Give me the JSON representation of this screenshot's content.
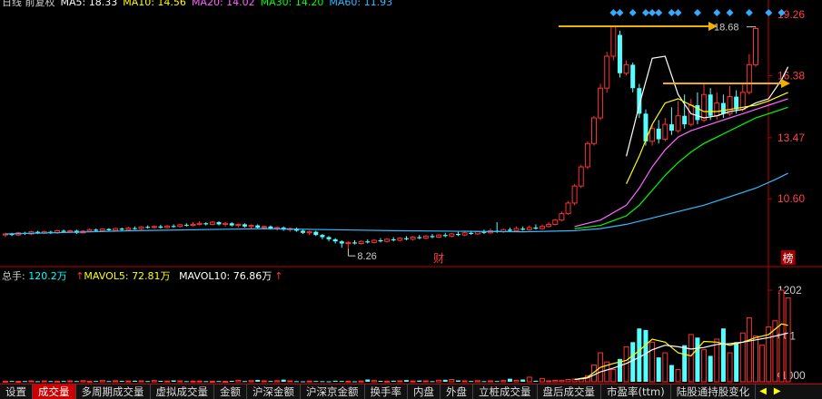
{
  "top_legend": {
    "items": [
      {
        "label": "日线 前复权",
        "color": "#cccccc"
      },
      {
        "label": "MA5: 18.33",
        "color": "#ffffff"
      },
      {
        "label": "MA10: 14.56",
        "color": "#ffff00"
      },
      {
        "label": "MA20: 14.02",
        "color": "#ff66ff"
      },
      {
        "label": "MA30: 14.20",
        "color": "#00ff00"
      },
      {
        "label": "MA60: 11.93",
        "color": "#33bbff"
      }
    ]
  },
  "volume_legend": {
    "total_label": "总手: ",
    "total_value": "120.2万",
    "mavol5_label": "MAVOL5: ",
    "mavol5_value": "72.81万",
    "mavol10_label": "MAVOL10: ",
    "mavol10_value": "76.86万"
  },
  "tabs": [
    "设置",
    "成交量",
    "多周期成交量",
    "虚拟成交量",
    "金额",
    "沪深金额",
    "沪深京金额",
    "换手率",
    "内盘",
    "外盘",
    "立桩成交量",
    "盘后成交量",
    "市盈率(ttm)",
    "陆股通持股变化"
  ],
  "active_tab": "成交量",
  "tab_arrows": [
    "◀",
    "▶"
  ],
  "colors": {
    "up": "#ff3232",
    "down": "#54ffff",
    "axis": "#c00000",
    "price_label": "#ff4040",
    "annotation_arrow": "#f0b000",
    "diamond": "#33aaff"
  },
  "chart_data": [
    {
      "type": "candlestick",
      "ylim": [
        7.5,
        19.6
      ],
      "yticks": [
        "19.26",
        "16.38",
        "13.47",
        "10.60"
      ],
      "annotations": {
        "high": "18.68",
        "low": "8.26",
        "markers": [
          "财",
          "榜"
        ]
      },
      "series": [
        {
          "name": "MA5",
          "color": "#ffffff"
        },
        {
          "name": "MA10",
          "color": "#ffff00"
        },
        {
          "name": "MA20",
          "color": "#ff66ff"
        },
        {
          "name": "MA30",
          "color": "#00ff00"
        },
        {
          "name": "MA60",
          "color": "#33bbff"
        }
      ],
      "candles": [
        [
          8.9,
          8.95,
          8.8,
          9.0
        ],
        [
          8.95,
          8.9,
          8.85,
          9.0
        ],
        [
          8.9,
          9.0,
          8.85,
          9.05
        ],
        [
          9.0,
          8.95,
          8.9,
          9.05
        ],
        [
          8.95,
          9.05,
          8.9,
          9.1
        ],
        [
          9.05,
          8.98,
          8.95,
          9.1
        ],
        [
          8.98,
          9.05,
          8.95,
          9.1
        ],
        [
          9.05,
          9.0,
          8.95,
          9.1
        ],
        [
          9.0,
          9.1,
          8.95,
          9.15
        ],
        [
          9.1,
          9.05,
          9.0,
          9.15
        ],
        [
          9.05,
          9.1,
          9.0,
          9.15
        ],
        [
          9.1,
          9.0,
          8.95,
          9.15
        ],
        [
          9.0,
          9.08,
          8.98,
          9.12
        ],
        [
          9.08,
          9.15,
          9.05,
          9.2
        ],
        [
          9.15,
          9.1,
          9.05,
          9.2
        ],
        [
          9.1,
          9.18,
          9.05,
          9.22
        ],
        [
          9.18,
          9.12,
          9.1,
          9.22
        ],
        [
          9.12,
          9.2,
          9.1,
          9.25
        ],
        [
          9.2,
          9.15,
          9.1,
          9.25
        ],
        [
          9.15,
          9.22,
          9.1,
          9.28
        ],
        [
          9.22,
          9.2,
          9.15,
          9.3
        ],
        [
          9.2,
          9.28,
          9.15,
          9.32
        ],
        [
          9.28,
          9.25,
          9.2,
          9.35
        ],
        [
          9.25,
          9.3,
          9.2,
          9.35
        ],
        [
          9.3,
          9.25,
          9.2,
          9.38
        ],
        [
          9.25,
          9.32,
          9.2,
          9.38
        ],
        [
          9.32,
          9.3,
          9.25,
          9.4
        ],
        [
          9.3,
          9.38,
          9.25,
          9.42
        ],
        [
          9.38,
          9.35,
          9.3,
          9.45
        ],
        [
          9.35,
          9.4,
          9.3,
          9.5
        ],
        [
          9.4,
          9.45,
          9.35,
          9.55
        ],
        [
          9.45,
          9.4,
          9.35,
          9.5
        ],
        [
          9.4,
          9.5,
          9.35,
          9.55
        ],
        [
          9.5,
          9.4,
          9.35,
          9.55
        ],
        [
          9.4,
          9.45,
          9.3,
          9.5
        ],
        [
          9.45,
          9.35,
          9.3,
          9.5
        ],
        [
          9.35,
          9.4,
          9.25,
          9.45
        ],
        [
          9.4,
          9.3,
          9.25,
          9.45
        ],
        [
          9.3,
          9.35,
          9.2,
          9.4
        ],
        [
          9.35,
          9.25,
          9.2,
          9.4
        ],
        [
          9.25,
          9.3,
          9.15,
          9.35
        ],
        [
          9.3,
          9.2,
          9.15,
          9.35
        ],
        [
          9.2,
          9.25,
          9.1,
          9.3
        ],
        [
          9.25,
          9.15,
          9.1,
          9.3
        ],
        [
          9.15,
          9.2,
          9.05,
          9.25
        ],
        [
          9.2,
          9.1,
          9.05,
          9.25
        ],
        [
          9.1,
          9.0,
          8.95,
          9.15
        ],
        [
          9.0,
          9.05,
          8.9,
          9.1
        ],
        [
          9.05,
          8.9,
          8.85,
          9.1
        ],
        [
          8.9,
          8.8,
          8.7,
          8.95
        ],
        [
          8.8,
          8.7,
          8.6,
          8.85
        ],
        [
          8.7,
          8.6,
          8.5,
          8.75
        ],
        [
          8.6,
          8.5,
          8.3,
          8.65
        ],
        [
          8.5,
          8.55,
          8.26,
          8.6
        ],
        [
          8.55,
          8.5,
          8.45,
          8.65
        ],
        [
          8.5,
          8.6,
          8.45,
          8.65
        ],
        [
          8.6,
          8.55,
          8.5,
          8.7
        ],
        [
          8.55,
          8.65,
          8.5,
          8.7
        ],
        [
          8.65,
          8.6,
          8.55,
          8.75
        ],
        [
          8.6,
          8.7,
          8.55,
          8.75
        ],
        [
          8.7,
          8.65,
          8.6,
          8.8
        ],
        [
          8.65,
          8.75,
          8.6,
          8.8
        ],
        [
          8.75,
          8.7,
          8.65,
          8.85
        ],
        [
          8.7,
          8.8,
          8.65,
          8.85
        ],
        [
          8.8,
          8.75,
          8.7,
          8.9
        ],
        [
          8.75,
          8.85,
          8.7,
          8.9
        ],
        [
          8.85,
          8.8,
          8.75,
          8.95
        ],
        [
          8.8,
          8.9,
          8.75,
          8.95
        ],
        [
          8.9,
          8.85,
          8.8,
          9.0
        ],
        [
          8.85,
          8.95,
          8.8,
          9.0
        ],
        [
          8.95,
          8.9,
          8.85,
          9.05
        ],
        [
          8.9,
          9.0,
          8.85,
          9.05
        ],
        [
          9.0,
          8.95,
          8.9,
          9.1
        ],
        [
          8.95,
          9.05,
          8.9,
          9.1
        ],
        [
          9.05,
          9.0,
          8.95,
          9.15
        ],
        [
          9.0,
          9.1,
          8.95,
          9.2
        ],
        [
          9.1,
          9.05,
          9.0,
          9.5
        ],
        [
          9.05,
          9.15,
          9.0,
          9.2
        ],
        [
          9.15,
          9.1,
          9.05,
          9.25
        ],
        [
          9.1,
          9.2,
          9.05,
          9.3
        ],
        [
          9.2,
          9.15,
          9.1,
          9.3
        ],
        [
          9.15,
          9.25,
          9.1,
          9.35
        ],
        [
          9.25,
          9.2,
          9.15,
          9.4
        ],
        [
          9.2,
          9.3,
          9.15,
          9.4
        ],
        [
          9.3,
          9.4,
          9.25,
          9.5
        ],
        [
          9.4,
          9.6,
          9.35,
          9.65
        ],
        [
          9.6,
          9.9,
          9.55,
          10.0
        ],
        [
          9.9,
          10.4,
          9.85,
          10.5
        ],
        [
          10.4,
          11.2,
          10.3,
          11.3
        ],
        [
          11.2,
          12.1,
          11.1,
          12.2
        ],
        [
          12.1,
          13.2,
          12.0,
          13.3
        ],
        [
          13.2,
          14.4,
          13.1,
          14.5
        ],
        [
          14.4,
          15.8,
          14.3,
          16.0
        ],
        [
          15.8,
          17.3,
          15.6,
          17.5
        ],
        [
          17.3,
          18.68,
          17.1,
          18.68
        ],
        [
          18.3,
          16.5,
          16.3,
          18.5
        ],
        [
          16.5,
          16.9,
          16.4,
          17.1
        ],
        [
          16.9,
          15.8,
          15.6,
          17.0
        ],
        [
          15.8,
          14.6,
          14.4,
          16.0
        ],
        [
          14.6,
          13.3,
          13.1,
          14.8
        ],
        [
          13.3,
          13.9,
          13.1,
          14.1
        ],
        [
          13.9,
          13.4,
          13.2,
          14.3
        ],
        [
          13.4,
          14.1,
          13.3,
          14.4
        ],
        [
          14.1,
          13.8,
          13.6,
          14.9
        ],
        [
          13.8,
          14.5,
          13.7,
          15.2
        ],
        [
          14.5,
          14.1,
          13.9,
          15.5
        ],
        [
          14.1,
          15.0,
          14.0,
          15.3
        ],
        [
          15.0,
          14.3,
          14.1,
          15.6
        ],
        [
          14.3,
          15.5,
          14.2,
          16.0
        ],
        [
          15.5,
          14.5,
          14.3,
          15.8
        ],
        [
          14.5,
          15.1,
          14.3,
          15.6
        ],
        [
          15.1,
          14.6,
          14.4,
          15.5
        ],
        [
          14.6,
          15.4,
          14.5,
          15.9
        ],
        [
          15.4,
          14.8,
          14.6,
          15.7
        ],
        [
          14.8,
          15.6,
          14.7,
          16.0
        ],
        [
          15.6,
          16.9,
          15.5,
          17.4
        ],
        [
          16.9,
          18.6,
          16.8,
          18.68
        ]
      ],
      "ma_values": {
        "MA5": [
          [
            96,
            12.6
          ],
          [
            98,
            15.0
          ],
          [
            100,
            17.2
          ],
          [
            102,
            17.3
          ],
          [
            104,
            15.5
          ],
          [
            106,
            14.6
          ],
          [
            108,
            14.4
          ],
          [
            110,
            14.5
          ],
          [
            112,
            14.7
          ],
          [
            114,
            14.8
          ],
          [
            116,
            15.1
          ],
          [
            118,
            15.3
          ],
          [
            120,
            16.2
          ],
          [
            121,
            16.8
          ]
        ],
        "MA10": [
          [
            96,
            11.3
          ],
          [
            98,
            12.6
          ],
          [
            100,
            14.1
          ],
          [
            102,
            15.1
          ],
          [
            104,
            15.3
          ],
          [
            106,
            15.0
          ],
          [
            108,
            14.7
          ],
          [
            110,
            14.7
          ],
          [
            112,
            14.8
          ],
          [
            114,
            14.9
          ],
          [
            116,
            15.0
          ],
          [
            118,
            15.2
          ],
          [
            121,
            15.6
          ]
        ],
        "MA20": [
          [
            88,
            9.3
          ],
          [
            92,
            9.6
          ],
          [
            96,
            10.3
          ],
          [
            98,
            11.1
          ],
          [
            100,
            12.1
          ],
          [
            102,
            12.9
          ],
          [
            104,
            13.5
          ],
          [
            106,
            13.8
          ],
          [
            108,
            14.0
          ],
          [
            110,
            14.2
          ],
          [
            112,
            14.4
          ],
          [
            114,
            14.6
          ],
          [
            116,
            14.8
          ],
          [
            118,
            15.0
          ],
          [
            121,
            15.3
          ]
        ],
        "MA30": [
          [
            88,
            9.2
          ],
          [
            92,
            9.35
          ],
          [
            96,
            9.8
          ],
          [
            98,
            10.3
          ],
          [
            100,
            11.0
          ],
          [
            102,
            11.7
          ],
          [
            104,
            12.3
          ],
          [
            106,
            12.8
          ],
          [
            108,
            13.2
          ],
          [
            110,
            13.5
          ],
          [
            112,
            13.8
          ],
          [
            114,
            14.1
          ],
          [
            116,
            14.4
          ],
          [
            118,
            14.6
          ],
          [
            121,
            14.9
          ]
        ],
        "MA60": [
          [
            0,
            8.95
          ],
          [
            20,
            9.1
          ],
          [
            40,
            9.2
          ],
          [
            60,
            9.1
          ],
          [
            80,
            9.05
          ],
          [
            88,
            9.1
          ],
          [
            92,
            9.2
          ],
          [
            96,
            9.4
          ],
          [
            100,
            9.7
          ],
          [
            104,
            10.0
          ],
          [
            108,
            10.3
          ],
          [
            112,
            10.7
          ],
          [
            116,
            11.1
          ],
          [
            119,
            11.5
          ],
          [
            121,
            11.8
          ]
        ]
      },
      "diamond_marker_indices": [
        94,
        95,
        97,
        99,
        100,
        101,
        103,
        104,
        107,
        110,
        112,
        115,
        118,
        120
      ]
    },
    {
      "type": "bar",
      "title": "成交量",
      "ylim": [
        0,
        1250
      ],
      "yticks": [
        "1202",
        "601"
      ],
      "unit": "X1000",
      "values": [
        8,
        10,
        6,
        9,
        12,
        7,
        11,
        9,
        8,
        10,
        12,
        9,
        14,
        8,
        10,
        16,
        9,
        13,
        11,
        10,
        14,
        12,
        9,
        16,
        12,
        10,
        18,
        11,
        8,
        9,
        10,
        8,
        7,
        9,
        6,
        12,
        18,
        9,
        14,
        24,
        12,
        10,
        14,
        28,
        12,
        8,
        6,
        10,
        10,
        8,
        6,
        14,
        10,
        8,
        6,
        10,
        30,
        16,
        12,
        8,
        14,
        12,
        22,
        10,
        16,
        12,
        8,
        20,
        26,
        30,
        18,
        12,
        10,
        14,
        8,
        12,
        10,
        16,
        40,
        18,
        30,
        60,
        14,
        40,
        12,
        18,
        16,
        30,
        35,
        38,
        80,
        220,
        380,
        260,
        160,
        300,
        460,
        520,
        700,
        680,
        520,
        320,
        380,
        220,
        160,
        480,
        620,
        580,
        420,
        340,
        560,
        700,
        380,
        520,
        640,
        840,
        600,
        480,
        720,
        800,
        1202,
        1100
      ],
      "mavol5": [
        [
          88,
          30
        ],
        [
          90,
          60
        ],
        [
          92,
          190
        ],
        [
          94,
          240
        ],
        [
          96,
          280
        ],
        [
          98,
          410
        ],
        [
          100,
          560
        ],
        [
          102,
          520
        ],
        [
          104,
          380
        ],
        [
          106,
          340
        ],
        [
          108,
          530
        ],
        [
          110,
          520
        ],
        [
          112,
          480
        ],
        [
          114,
          520
        ],
        [
          116,
          580
        ],
        [
          118,
          620
        ],
        [
          120,
          760
        ],
        [
          121,
          740
        ]
      ],
      "mavol10": [
        [
          88,
          28
        ],
        [
          90,
          50
        ],
        [
          92,
          130
        ],
        [
          94,
          180
        ],
        [
          96,
          240
        ],
        [
          98,
          320
        ],
        [
          100,
          420
        ],
        [
          102,
          480
        ],
        [
          104,
          460
        ],
        [
          106,
          430
        ],
        [
          108,
          450
        ],
        [
          110,
          490
        ],
        [
          112,
          500
        ],
        [
          114,
          520
        ],
        [
          116,
          550
        ],
        [
          118,
          580
        ],
        [
          120,
          620
        ],
        [
          121,
          640
        ]
      ]
    }
  ]
}
